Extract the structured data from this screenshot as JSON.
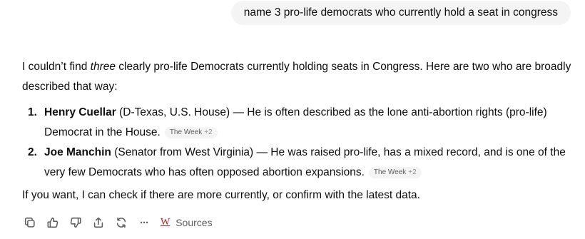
{
  "user_message": "name 3 pro-life democrats who currently hold a seat in congress",
  "assistant": {
    "intro_before": "I couldn’t find ",
    "intro_em": "three",
    "intro_after": " clearly pro-life Democrats currently holding seats in Congress. Here are two who are broadly described that way:",
    "items": [
      {
        "number": "1.",
        "name": "Henry Cuellar",
        "text": " (D-Texas, U.S. House) — He is often described as the lone anti-abortion rights (pro-life) Democrat in the House.",
        "cite_source": "The Week",
        "cite_more": "+2"
      },
      {
        "number": "2.",
        "name": "Joe Manchin",
        "text": " (Senator from West Virginia) — He was raised pro-life, has a mixed record, and is one of the very few Democrats who has often opposed abortion expansions.",
        "cite_source": "The Week",
        "cite_more": "+2"
      }
    ],
    "closing": "If you want, I can check if there are more currently, or confirm with the latest data."
  },
  "actions": {
    "icons": [
      "copy-icon",
      "thumbs-up-icon",
      "thumbs-down-icon",
      "share-icon",
      "regenerate-icon",
      "more-icon"
    ],
    "more_glyph": "···",
    "sources_logo": "W",
    "sources_label": "Sources"
  }
}
